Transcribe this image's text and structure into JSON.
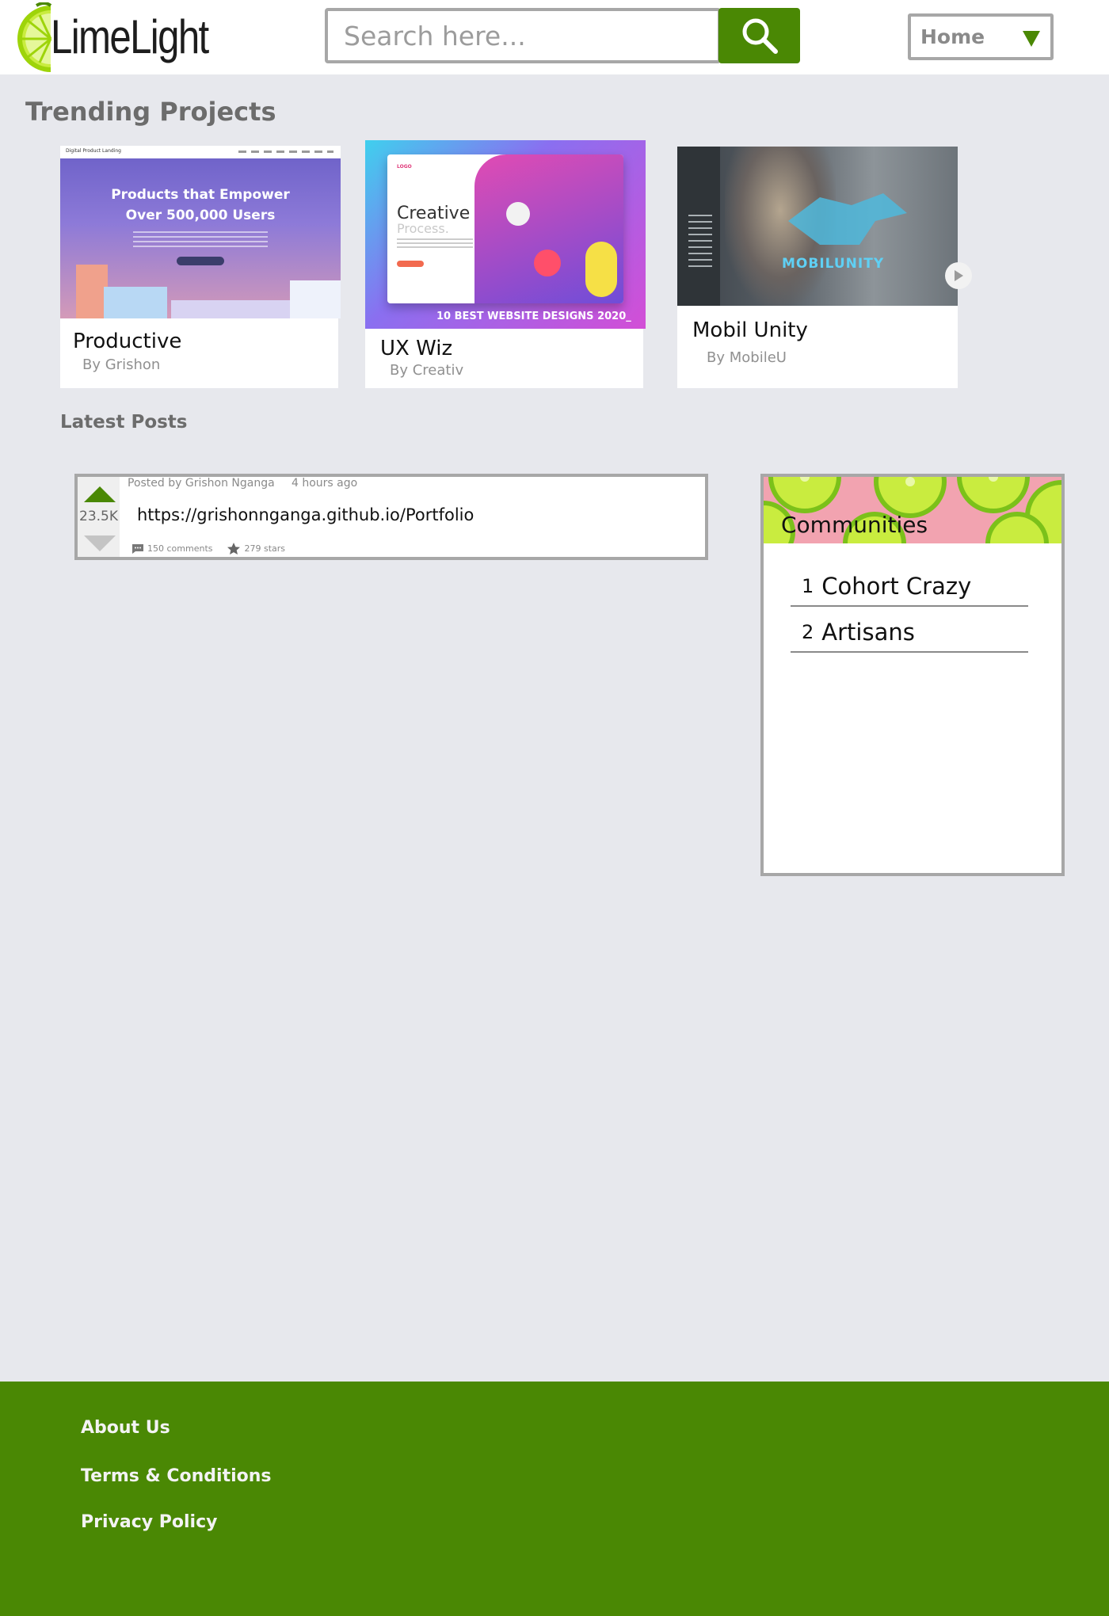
{
  "header": {
    "logo_text": "LimeLight",
    "search_placeholder": "Search here...",
    "nav_select": "Home"
  },
  "trending": {
    "title": "Trending Projects",
    "projects": [
      {
        "title": "Productive",
        "author": "By Grishon",
        "thumb": {
          "brand": "Digital Product Landing",
          "headline1": "Products that Empower",
          "headline2": "Over 500,000 Users"
        }
      },
      {
        "title": "UX Wiz",
        "author": "By Creativ",
        "thumb": {
          "heading": "Creative",
          "subheading": "Process.",
          "logo": "LOGO",
          "caption": "10 BEST WEBSITE DESIGNS 2020_"
        }
      },
      {
        "title": "Mobil Unity",
        "author": "By MobileU",
        "thumb": {
          "brand": "MOBILUNITY"
        }
      }
    ]
  },
  "posts": {
    "title": "Latest Posts",
    "items": [
      {
        "author": "Posted by Grishon Nganga",
        "time": "4 hours ago",
        "votes": "23.5K",
        "link": "https://grishonnganga.github.io/Portfolio",
        "comments": "150 comments",
        "stars": "279 stars"
      }
    ]
  },
  "communities": {
    "title": "Communities",
    "items": [
      {
        "rank": "1",
        "name": "Cohort Crazy"
      },
      {
        "rank": "2",
        "name": "Artisans"
      }
    ]
  },
  "footer": {
    "links": [
      "About Us",
      "Terms & Conditions",
      "Privacy Policy"
    ]
  },
  "colors": {
    "brand_green": "#4a8804",
    "background": "#e7e8ed",
    "border_gray": "#a7a7a7"
  }
}
